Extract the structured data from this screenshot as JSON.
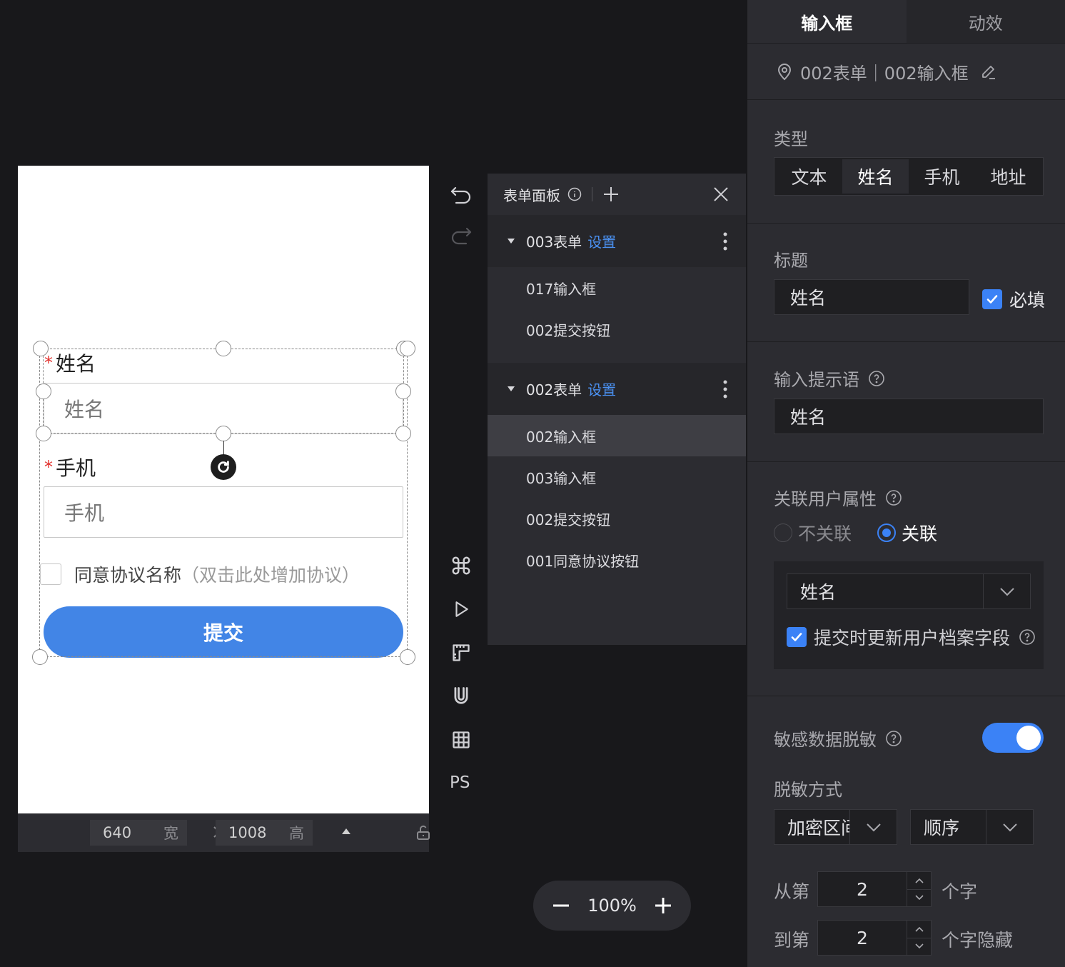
{
  "canvas": {
    "name_label": "姓名",
    "name_placeholder": "姓名",
    "phone_label": "手机",
    "phone_placeholder": "手机",
    "required_mark": "*",
    "agree_text": "同意协议名称",
    "agree_hint": "（双击此处增加协议）",
    "submit_label": "提交"
  },
  "sizebar": {
    "width": "640",
    "width_unit": "宽",
    "height": "1008",
    "height_unit": "高"
  },
  "tools": {
    "ps_label": "PS"
  },
  "form_panel": {
    "title": "表单面板",
    "groups": [
      {
        "name": "003表单",
        "link": "设置",
        "items": [
          "017输入框",
          "002提交按钮"
        ]
      },
      {
        "name": "002表单",
        "link": "设置",
        "items": [
          "002输入框",
          "003输入框",
          "002提交按钮",
          "001同意协议按钮"
        ]
      }
    ]
  },
  "zoom": {
    "value": "100%"
  },
  "props": {
    "tabs": [
      "输入框",
      "动效"
    ],
    "path": "002表单｜002输入框",
    "type_label": "类型",
    "type_options": [
      "文本",
      "姓名",
      "手机",
      "地址"
    ],
    "title_label": "标题",
    "title_value": "姓名",
    "required_label": "必填",
    "hint_label": "输入提示语",
    "hint_value": "姓名",
    "assoc_label": "关联用户属性",
    "assoc_off": "不关联",
    "assoc_on": "关联",
    "assoc_select": "姓名",
    "update_label": "提交时更新用户档案字段",
    "mask_label": "敏感数据脱敏",
    "mask_method_label": "脱敏方式",
    "mask_method": "加密区间",
    "mask_order": "顺序",
    "from_label": "从第",
    "from_value": "2",
    "from_suffix": "个字",
    "to_label": "到第",
    "to_value": "2",
    "to_suffix": "个字隐藏"
  },
  "colors": {
    "accent": "#3b82f6",
    "submit": "#4285e6",
    "required": "#e2312d"
  }
}
